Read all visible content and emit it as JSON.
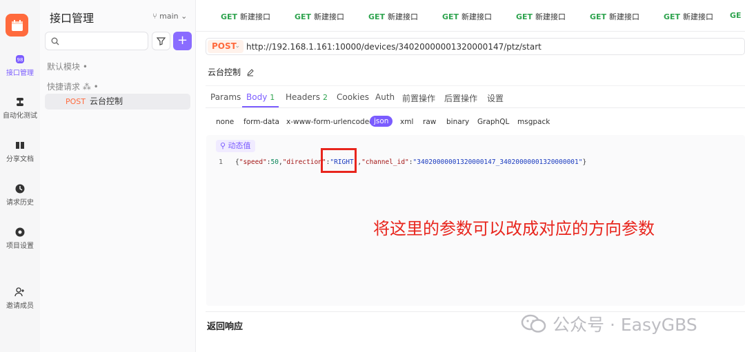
{
  "rail": {
    "items": [
      {
        "label": "接口管理",
        "icon": "api-icon"
      },
      {
        "label": "自动化测试",
        "icon": "automation-icon"
      },
      {
        "label": "分享文档",
        "icon": "book-icon"
      },
      {
        "label": "请求历史",
        "icon": "history-icon"
      },
      {
        "label": "项目设置",
        "icon": "settings-icon"
      },
      {
        "label": "邀请成员",
        "icon": "invite-icon"
      }
    ]
  },
  "sidebar": {
    "title": "接口管理",
    "branch": "main",
    "groups": [
      "默认模块 •",
      "快捷请求 ⁂ •"
    ],
    "item": {
      "method": "POST",
      "label": "云台控制"
    }
  },
  "tabs": [
    {
      "method": "GET",
      "label": "新建接口"
    },
    {
      "method": "GET",
      "label": "新建接口"
    },
    {
      "method": "GET",
      "label": "新建接口"
    },
    {
      "method": "GET",
      "label": "新建接口"
    },
    {
      "method": "GET",
      "label": "新建接口"
    },
    {
      "method": "GET",
      "label": "新建接口"
    },
    {
      "method": "GET",
      "label": "新建接口"
    },
    {
      "method": "GE",
      "label": ""
    }
  ],
  "request": {
    "method": "POST",
    "url": "http://192.168.1.161:10000/devices/34020000001320000147/ptz/start",
    "title": "云台控制"
  },
  "param_tabs": [
    {
      "label": "Params",
      "count": ""
    },
    {
      "label": "Body",
      "count": "1"
    },
    {
      "label": "Headers",
      "count": "2"
    },
    {
      "label": "Cookies",
      "count": ""
    },
    {
      "label": "Auth",
      "count": ""
    },
    {
      "label": "前置操作",
      "count": ""
    },
    {
      "label": "后置操作",
      "count": ""
    },
    {
      "label": "设置",
      "count": ""
    }
  ],
  "body_types": [
    "none",
    "form-data",
    "x-www-form-urlencoded",
    "json",
    "xml",
    "raw",
    "binary",
    "GraphQL",
    "msgpack"
  ],
  "editor": {
    "dynamic_value": "⚲ 动态值",
    "line_number": "1",
    "code_open": "{",
    "k_speed": "\"speed\"",
    "colon": ":",
    "v_speed": "50",
    "comma": ",",
    "k_direction": "\"direction\"",
    "v_direction": "\"RIGHT\"",
    "k_channel": "\"channel_id\"",
    "v_channel": "\"34020000001320000147_34020000001320000001\"",
    "code_close": "}"
  },
  "annotation": "将这里的参数可以改成对应的方向参数",
  "response": {
    "title": "返回响应"
  },
  "watermark": "公众号 · EasyGBS",
  "colors": {
    "accent": "#7b5cff",
    "post": "#ff6a3d",
    "get": "#2fa44f",
    "annotation": "#e8251d"
  }
}
